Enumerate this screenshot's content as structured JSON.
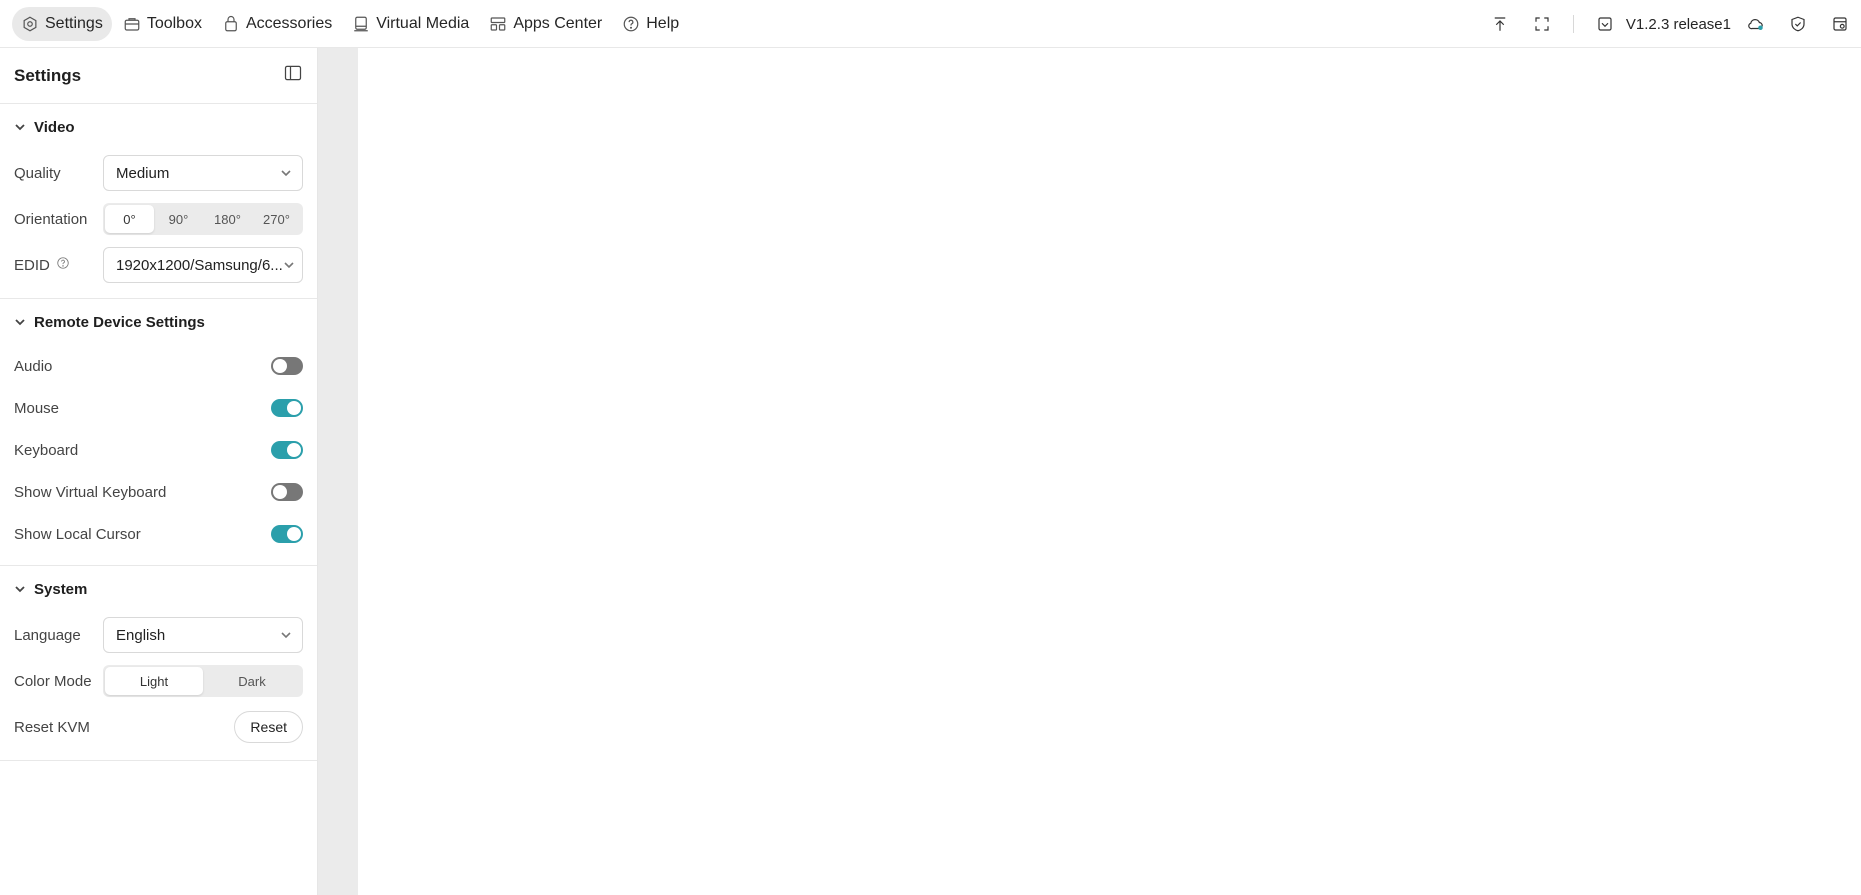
{
  "topnav": {
    "items": [
      {
        "label": "Settings",
        "icon": "settings-icon",
        "active": true
      },
      {
        "label": "Toolbox",
        "icon": "toolbox-icon"
      },
      {
        "label": "Accessories",
        "icon": "accessories-icon"
      },
      {
        "label": "Virtual Media",
        "icon": "virtual-media-icon"
      },
      {
        "label": "Apps Center",
        "icon": "apps-center-icon"
      },
      {
        "label": "Help",
        "icon": "help-icon"
      }
    ]
  },
  "topright": {
    "version": "V1.2.3 release1",
    "icons": [
      "upload-icon",
      "fullscreen-icon",
      "download-check-icon",
      "cloud-status-icon",
      "shield-check-icon",
      "notifications-icon"
    ],
    "cloud_dot_color": "#2b9fab"
  },
  "sidebar": {
    "title": "Settings",
    "video": {
      "heading": "Video",
      "quality_label": "Quality",
      "quality_value": "Medium",
      "orientation_label": "Orientation",
      "orientation_options": [
        "0°",
        "90°",
        "180°",
        "270°"
      ],
      "orientation_selected": "0°",
      "edid_label": "EDID",
      "edid_value": "1920x1200/Samsung/6..."
    },
    "remote": {
      "heading": "Remote Device Settings",
      "toggles": [
        {
          "label": "Audio",
          "on": false
        },
        {
          "label": "Mouse",
          "on": true
        },
        {
          "label": "Keyboard",
          "on": true
        },
        {
          "label": "Show Virtual Keyboard",
          "on": false
        },
        {
          "label": "Show Local Cursor",
          "on": true
        }
      ]
    },
    "system": {
      "heading": "System",
      "language_label": "Language",
      "language_value": "English",
      "color_mode_label": "Color Mode",
      "color_mode_options": [
        "Light",
        "Dark"
      ],
      "color_mode_selected": "Light",
      "reset_label": "Reset KVM",
      "reset_button": "Reset"
    }
  },
  "colors": {
    "accent": "#2b9fab",
    "toggle_off": "#777777",
    "gutter": "#ebebeb"
  }
}
